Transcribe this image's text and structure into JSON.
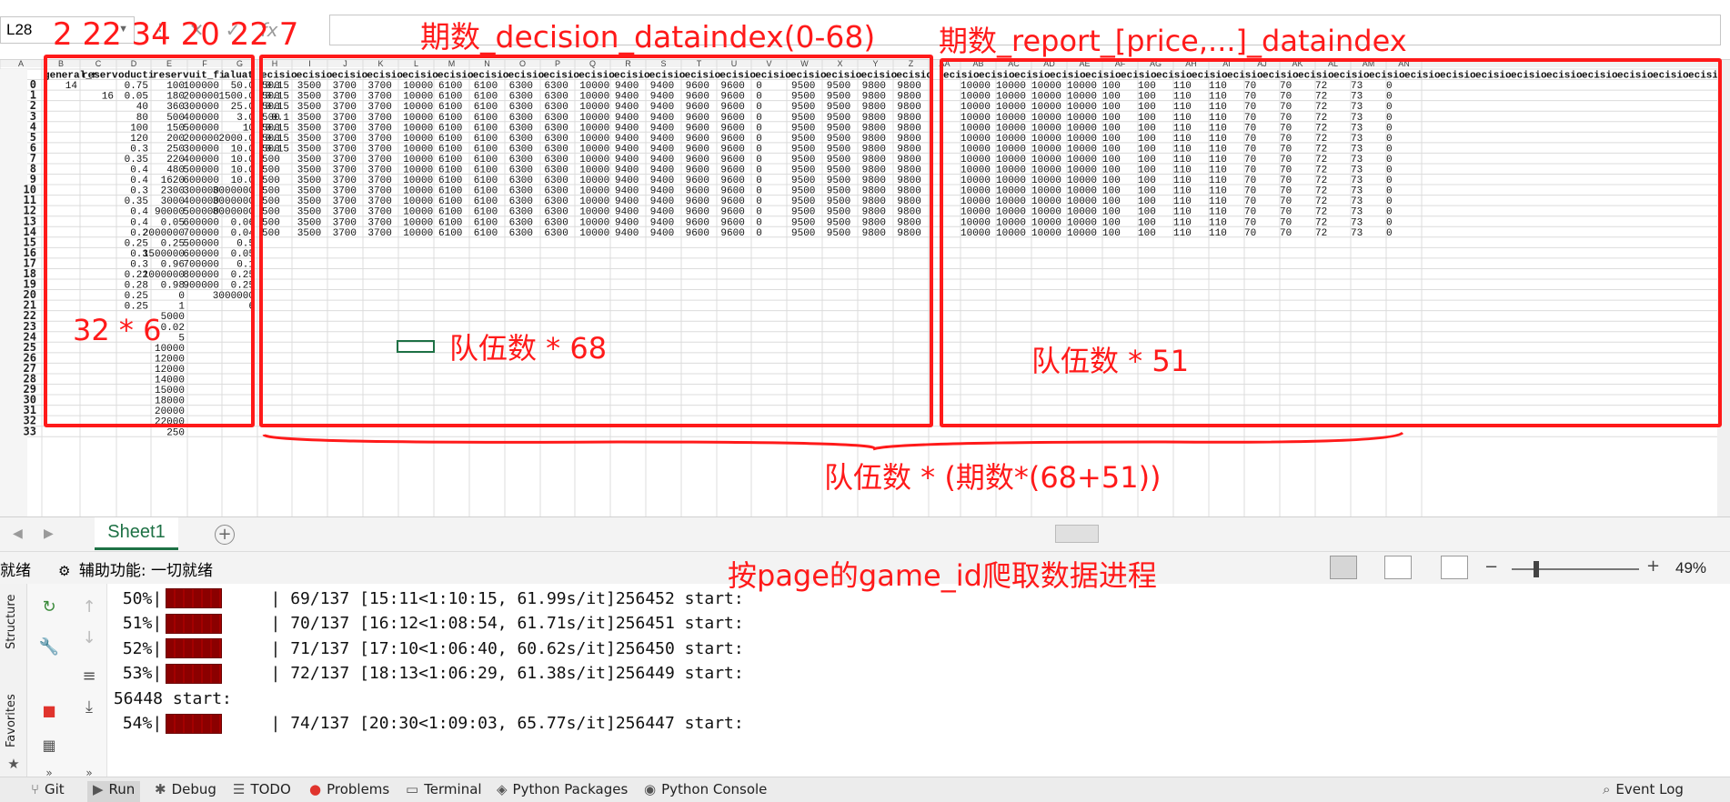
{
  "formula_bar": {
    "name_box": "L28",
    "fx_symbol": "fx",
    "cancel_symbol": "✕",
    "enter_symbol": "✓"
  },
  "columns": [
    "A",
    "B",
    "C",
    "D",
    "E",
    "F",
    "G",
    "H",
    "I",
    "J",
    "K",
    "L",
    "M",
    "N",
    "O",
    "P",
    "Q",
    "R",
    "S",
    "T",
    "U",
    "V",
    "W",
    "X",
    "Y",
    "Z",
    "AA",
    "AB",
    "AC",
    "AD",
    "AE",
    "AF",
    "AG",
    "AH",
    "AI",
    "AJ",
    "AK",
    "AL",
    "AM",
    "AN"
  ],
  "rows": {
    "header": [
      "general_r",
      "reserv",
      "oducti",
      "reserv",
      "uit_fi",
      "aluat"
    ],
    "index_col": [
      0,
      1,
      2,
      3,
      4,
      5,
      6,
      7,
      8,
      9,
      10,
      11,
      12,
      13,
      14,
      15,
      16,
      17,
      18,
      19,
      20,
      21,
      22,
      23,
      24,
      25,
      26,
      27,
      28,
      29,
      30,
      31,
      32,
      33
    ],
    "col_b": [
      "14",
      "",
      "",
      "",
      "",
      "",
      "",
      "",
      "",
      "",
      "",
      "",
      "",
      "",
      "",
      "",
      "",
      "",
      "",
      "",
      "",
      "",
      "",
      "",
      "",
      "",
      "",
      "",
      "",
      "",
      "",
      "",
      "",
      ""
    ],
    "col_c": [
      "",
      "16",
      "",
      "",
      "",
      "",
      "",
      "",
      "",
      "",
      "",
      "",
      "",
      "",
      "",
      "",
      "",
      "",
      "",
      "",
      "",
      "",
      "",
      "",
      "",
      "",
      "",
      "",
      "",
      "",
      "",
      "",
      "",
      ""
    ],
    "col_d": [
      "0.75",
      "0.05",
      "40",
      "80",
      "100",
      "120",
      "0.3",
      "0.35",
      "0.4",
      "0.4",
      "0.3",
      "0.35",
      "0.4",
      "0.4",
      "0.2",
      "0.25",
      "0.3",
      "0.3",
      "0.22",
      "0.28",
      "0.25",
      "0.25",
      "",
      "",
      "",
      "",
      "",
      "",
      "",
      "",
      "",
      "",
      "",
      ""
    ],
    "col_e": [
      "100",
      "180",
      "360",
      "500",
      "150",
      "200",
      "250",
      "220",
      "480",
      "1620",
      "2300",
      "3000",
      "90000",
      "0.05",
      "2000000",
      "0.25",
      "1500000",
      "0.96",
      "1000000",
      "0.98",
      "0",
      "1",
      "5000",
      "0.02",
      "5",
      "10000",
      "12000",
      "12000",
      "14000",
      "15000",
      "18000",
      "20000",
      "22000",
      "250"
    ],
    "col_f": [
      "100000",
      "200000",
      "300000",
      "400000",
      "500000",
      "200000",
      "300000",
      "400000",
      "500000",
      "600000",
      "300000",
      "400000",
      "500000",
      "600000",
      "700000",
      "500000",
      "600000",
      "700000",
      "800000",
      "900000",
      "",
      "",
      "",
      "",
      "",
      "",
      "",
      "",
      "",
      "",
      "",
      "",
      "",
      ""
    ],
    "col_g": [
      "50.0",
      "1500.0",
      "25.0",
      "3.0",
      "10",
      "2000.0",
      "10.0",
      "10.0",
      "10.0",
      "10.0",
      "3000000",
      "3000000",
      "8000000",
      "0.06",
      "0.04",
      "0.5",
      "0.05",
      "0.1",
      "0.25",
      "0.25",
      "3000000",
      "6",
      "",
      "",
      "",
      "",
      "",
      "",
      "",
      "",
      "",
      "",
      "",
      ""
    ],
    "col_h": [
      "0.15",
      "0.15",
      "0.15",
      "0.1",
      "0.15",
      "0.15",
      "0.15",
      "",
      "",
      "",
      "",
      "",
      "",
      "",
      "",
      "",
      "",
      "",
      "",
      "",
      "",
      "",
      "",
      "",
      "",
      "",
      "",
      "",
      "",
      "",
      "",
      "",
      "",
      ""
    ]
  },
  "decision_block": {
    "header": "ecisio",
    "row_values": [
      "500",
      "3500",
      "3700",
      "3700",
      "10000",
      "6100",
      "6100",
      "6300",
      "6300",
      "10000",
      "9400",
      "9400",
      "9600",
      "9600",
      "0",
      "9500",
      "9500",
      "9800",
      "9800"
    ],
    "row_count": 15
  },
  "report_block": {
    "header": "ecisio",
    "row_values": [
      "10000",
      "10000",
      "10000",
      "10000",
      "100",
      "100",
      "110",
      "110",
      "70",
      "70",
      "72",
      "73",
      "0"
    ],
    "row_count": 15
  },
  "sheet_tabs": {
    "active": "Sheet1",
    "add": "+"
  },
  "status_bar": {
    "ready": "就绪",
    "accessibility": "辅助功能: 一切就绪",
    "zoom": "49%",
    "zoom_minus": "−",
    "zoom_plus": "+"
  },
  "ide": {
    "side_tabs": [
      "Structure",
      "Favorites"
    ],
    "console_lines": [
      {
        "pct": " 50%|",
        "tail": "| 69/137 [15:11<1:10:15, 61.99s/it]256452 start:",
        "bar": true
      },
      {
        "pct": " 51%|",
        "tail": "| 70/137 [16:12<1:08:54, 61.71s/it]256451 start:",
        "bar": true
      },
      {
        "pct": " 52%|",
        "tail": "| 71/137 [17:10<1:06:40, 60.62s/it]256450 start:",
        "bar": true
      },
      {
        "pct": " 53%|",
        "tail": "| 72/137 [18:13<1:06:29, 61.38s/it]256449 start:",
        "bar": true
      },
      {
        "pct": "256448 start:",
        "tail": "",
        "bar": false
      },
      {
        "pct": " 54%|",
        "tail": "| 74/137 [20:30<1:09:03, 65.77s/it]256447 start:",
        "bar": true
      }
    ],
    "bottom_tabs": [
      "Git",
      "Run",
      "Debug",
      "TODO",
      "Problems",
      "Terminal",
      "Python Packages",
      "Python Console",
      "Event Log"
    ]
  },
  "annotations": {
    "col_counts": "2 22 34 20 22 7",
    "decision_title": "期数_decision_dataindex(0-68)",
    "report_title": "期数_report_[price,...]_dataindex",
    "left_size": "32 * 6",
    "decision_size": "队伍数 * 68",
    "report_size": "队伍数 * 51",
    "total_size": "队伍数 * (期数*(68+51))",
    "progress_note": "按page的game_id爬取数据进程"
  },
  "colors": {
    "annotation": "#ff1a1a",
    "excel_green": "#1e7145",
    "progress_bar": "#8b0000"
  }
}
